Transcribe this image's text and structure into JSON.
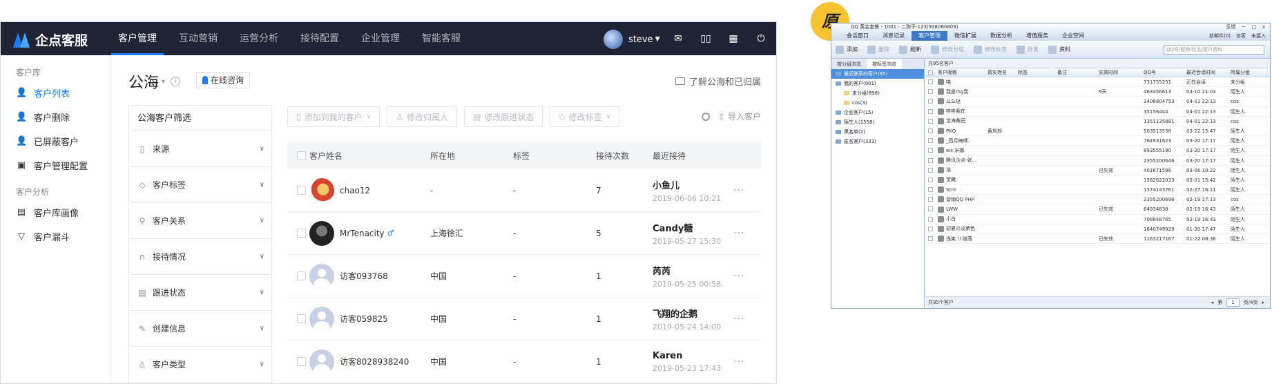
{
  "app": {
    "logo_text": "企点客服",
    "nav": [
      "客户管理",
      "互动营销",
      "运营分析",
      "接待配置",
      "企业管理",
      "智能客服"
    ],
    "user_name": "steve",
    "top_icons": [
      "mail-icon",
      "book-icon",
      "grid-icon",
      "logout-icon"
    ]
  },
  "sidebar": {
    "groups": [
      {
        "title": "客户库",
        "items": [
          {
            "label": "客户列表",
            "icon": "user-list-icon",
            "active": true
          },
          {
            "label": "客户删除",
            "icon": "user-delete-icon"
          },
          {
            "label": "已屏蔽客户",
            "icon": "user-block-icon"
          },
          {
            "label": "客户管理配置",
            "icon": "briefcase-icon"
          }
        ]
      },
      {
        "title": "客户分析",
        "items": [
          {
            "label": "客户库画像",
            "icon": "portrait-icon"
          },
          {
            "label": "客户漏斗",
            "icon": "funnel-icon"
          }
        ]
      }
    ]
  },
  "page": {
    "title": "公海",
    "consult_btn": "在线咨询",
    "learn_link": "了解公海和已归属"
  },
  "filter": {
    "title": "公海客户筛选",
    "items": [
      "来源",
      "客户标签",
      "客户关系",
      "接待情况",
      "跟进状态",
      "创建信息",
      "客户类型"
    ]
  },
  "toolbar": {
    "buttons": [
      "添加到我的客户",
      "修改归属人",
      "修改跟进状态",
      "修改标签"
    ],
    "import": "导入客户"
  },
  "table": {
    "headers": [
      "客户姓名",
      "所在地",
      "标签",
      "接待次数",
      "最近接待"
    ],
    "rows": [
      {
        "name": "chao12",
        "loc": "-",
        "tag": "-",
        "count": "7",
        "last_name": "小鱼儿",
        "last_time": "2019-06-06 10:21"
      },
      {
        "name": "MrTenacity",
        "gender": "♂",
        "loc": "上海徐汇",
        "tag": "-",
        "count": "5",
        "last_name": "Candy糖",
        "last_time": "2019-05-27 15:30"
      },
      {
        "name": "访客093768",
        "loc": "中国",
        "tag": "-",
        "count": "1",
        "last_name": "芮芮",
        "last_time": "2019-05-25 00:58"
      },
      {
        "name": "访客059825",
        "loc": "中国",
        "tag": "-",
        "count": "1",
        "last_name": "飞翔的企鹅",
        "last_time": "2019-05-24 14:00"
      },
      {
        "name": "访客8028938240",
        "loc": "中国",
        "tag": "-",
        "count": "1",
        "last_name": "Karen",
        "last_time": "2019-05-23 17:43"
      }
    ]
  },
  "badge": "原",
  "old": {
    "title": "QQ 黄金套餐 - 1001 - 二狗子-123(938060809)",
    "title_right": [
      "反馈",
      "－",
      "□",
      "×"
    ],
    "tabs": [
      "会话窗口",
      "消息记录",
      "客户管理",
      "微信扩展",
      "数据分析",
      "增值服务",
      "企业空间"
    ],
    "tabs_right": [
      "新邮件(0)",
      "访客",
      "未接入"
    ],
    "toolbar": [
      "添加",
      "删除",
      "刷新",
      "修改分组",
      "修改标签",
      "群发",
      "资料"
    ],
    "search_placeholder": "QQ号/昵称/姓名/客户资料",
    "left_tabs": [
      "按分组浏览",
      "按标签浏览"
    ],
    "tree": [
      "最近联系的客户(95)",
      "我的客户(901)",
      "未分组(898)",
      "cos(3)",
      "企业客户(15)",
      "陌生人(1558)",
      "黑名单(2)",
      "匿名客户(333)"
    ],
    "count": "共95名客户",
    "headers": [
      "客户昵称",
      "真实姓名",
      "标签",
      "备注",
      "失效时间",
      "QQ号",
      "最近会话时间",
      "所属分组"
    ],
    "rows": [
      [
        "喵",
        "",
        "",
        "",
        "",
        "731755251",
        "正在会话",
        "未分组"
      ],
      [
        "我是mg我",
        "",
        "",
        "",
        "9天",
        "463456613",
        "04-10 21:03",
        "陌生人"
      ],
      [
        "么么哒",
        "",
        "",
        "",
        "",
        "3408804753",
        "04-01 22:13",
        "cos"
      ],
      [
        "哆哆我在",
        "",
        "",
        "",
        "",
        "35156444",
        "04-01 22:13",
        "陌生人"
      ],
      [
        "沧海桑田",
        "",
        "",
        "",
        "",
        "1351135881",
        "04-01 22:13",
        "cos"
      ],
      [
        "PKQ",
        "黄旭旭",
        "",
        "",
        "",
        "503513558",
        "03-22 15:47",
        "陌生人"
      ],
      [
        "_西月梅绣.",
        "",
        "",
        "",
        "",
        "764931623",
        "03-20 17:17",
        "陌生人"
      ],
      [
        "eis 米娜.",
        "",
        "",
        "",
        "",
        "893555190",
        "03-20 17:17",
        "陌生人"
      ],
      [
        "腾讯企点-张...",
        "",
        "",
        "",
        "",
        "2355200646",
        "03-20 17:17",
        "陌生人"
      ],
      [
        "浩",
        "",
        "",
        "",
        "已失效",
        "401671596",
        "03-06 10:22",
        "陌生人"
      ],
      [
        "宝藏.",
        "",
        "",
        "",
        "",
        "1582622033",
        "03-01 15:42",
        "陌生人"
      ],
      [
        "Strlr",
        "",
        "",
        "",
        "",
        "1574143761",
        "02-27 16:11",
        "陌生人"
      ],
      [
        "营销QQ PHP",
        "",
        "",
        "",
        "",
        "2355200696",
        "02-19 17:13",
        "cos"
      ],
      [
        "LWW",
        "",
        "",
        "",
        "已失效",
        "64934838",
        "02-19 16:43",
        "陌生人"
      ],
      [
        "小白",
        "",
        "",
        "",
        "",
        "708848765",
        "02-19 16:43",
        "陌生人"
      ],
      [
        "初夏の淡紫色",
        "",
        "",
        "",
        "",
        "1640749929",
        "01-30 17:47",
        "陌生人"
      ],
      [
        "浅笑 !!.随落",
        "",
        "",
        "",
        "已失效",
        "1163217167",
        "01-22 08:36",
        "陌生人"
      ]
    ],
    "footer": "共95个客户",
    "pager": [
      "第",
      "1",
      "页/4页"
    ]
  },
  "colors": {
    "accent": "#1f7bf4",
    "topbar": "#1e2434",
    "badge": "#f7c331"
  }
}
